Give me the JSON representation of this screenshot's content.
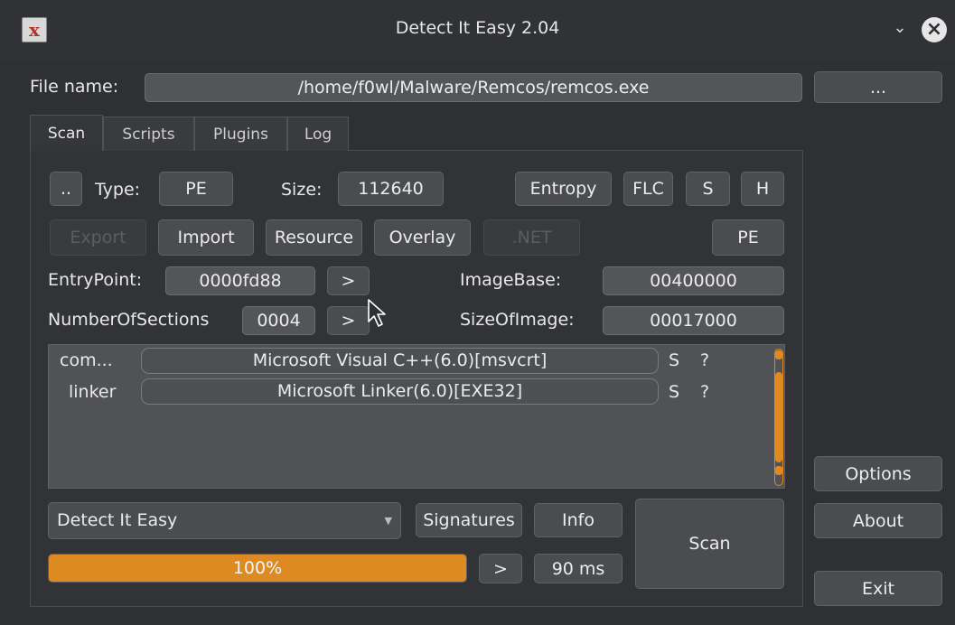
{
  "window": {
    "title": "Detect It Easy 2.04",
    "app_icon": "dIE-logo-icon",
    "minimize_icon": "chevron-down-icon",
    "close_icon": "close-icon"
  },
  "file": {
    "label": "File name:",
    "value": "/home/f0wl/Malware/Remcos/remcos.exe",
    "browse_label": "..."
  },
  "tabs": [
    {
      "label": "Scan",
      "active": true
    },
    {
      "label": "Scripts",
      "active": false
    },
    {
      "label": "Plugins",
      "active": false
    },
    {
      "label": "Log",
      "active": false
    }
  ],
  "scan": {
    "up_label": "..",
    "type_label": "Type:",
    "type_value": "PE",
    "size_label": "Size:",
    "size_value": "112640",
    "entropy_label": "Entropy",
    "flc_label": "FLC",
    "s_label": "S",
    "h_label": "H",
    "export_label": "Export",
    "import_label": "Import",
    "resource_label": "Resource",
    "overlay_label": "Overlay",
    "net_label": ".NET",
    "pe_label": "PE",
    "entrypoint_label": "EntryPoint:",
    "entrypoint_value": "0000fd88",
    "numsections_label": "NumberOfSections",
    "numsections_value": "0004",
    "go_label": ">",
    "imagebase_label": "ImageBase:",
    "imagebase_value": "00400000",
    "sizeofimage_label": "SizeOfImage:",
    "sizeofimage_value": "00017000"
  },
  "results": [
    {
      "type": "com...",
      "name": "Microsoft Visual C++(6.0)[msvcrt]",
      "s": "S",
      "q": "?"
    },
    {
      "type": "linker",
      "name": "Microsoft Linker(6.0)[EXE32]",
      "s": "S",
      "q": "?"
    }
  ],
  "bottom": {
    "engine_value": "Detect It Easy",
    "signatures_label": "Signatures",
    "info_label": "Info",
    "scan_label": "Scan",
    "progress_percent": 100,
    "progress_text": "100%",
    "next_label": ">",
    "time_value": "90 ms"
  },
  "side": {
    "options_label": "Options",
    "about_label": "About",
    "exit_label": "Exit"
  },
  "colors": {
    "accent": "#dd8a22",
    "background": "#2f3033"
  }
}
